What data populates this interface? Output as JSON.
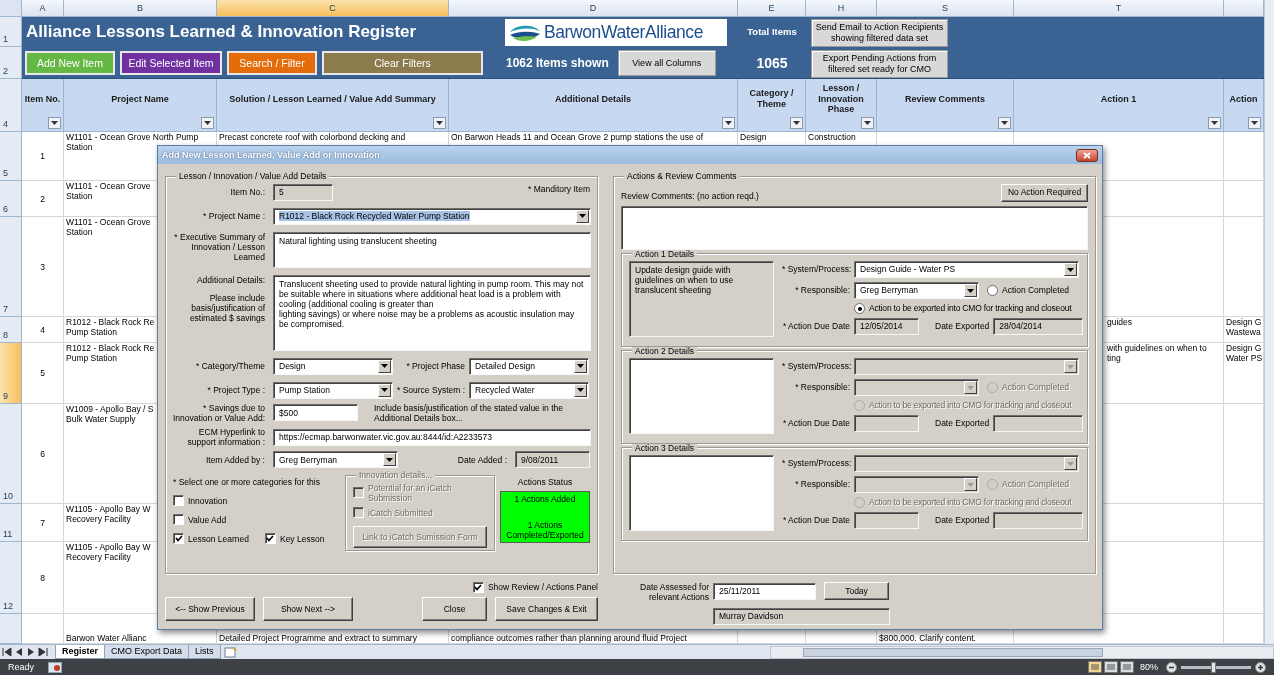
{
  "sheet": {
    "title": "Alliance Lessons Learned & Innovation Register",
    "columns": [
      {
        "letter": "A",
        "selected": false
      },
      {
        "letter": "B",
        "selected": false
      },
      {
        "letter": "C",
        "selected": true
      },
      {
        "letter": "D",
        "selected": false
      },
      {
        "letter": "E",
        "selected": false
      },
      {
        "letter": "H",
        "selected": false
      },
      {
        "letter": "S",
        "selected": false
      },
      {
        "letter": "T",
        "selected": false
      },
      {
        "selected": false
      }
    ],
    "toolbar_buttons": [
      {
        "label": "Add New Item",
        "color": "#66b845"
      },
      {
        "label": "Edit Selected Item",
        "color": "#7030a0"
      },
      {
        "label": "Search / Filter",
        "color": "#e46c0a"
      },
      {
        "label": "Clear Filters",
        "color": "#8c7b4c"
      }
    ],
    "logo": "BarwonWaterAlliance",
    "items_shown": "1062 Items shown",
    "view_button": "View all Columns",
    "total_label": "Total Items",
    "total_value": "1065",
    "side_buttons": [
      "Send Email to Action Recipients showing filtered data set",
      "Export Pending Actions from filtered set ready for CMO"
    ],
    "header_rows": [
      "1",
      "2",
      "4"
    ],
    "headers": [
      "Item No.",
      "Project Name",
      "Solution / Lesson Learned / Value Add Summary",
      "Additional Details",
      "Category / Theme",
      "Lesson / Innovation Phase",
      "Review Comments",
      "Action 1",
      "Action"
    ],
    "rows": [
      {
        "label": "5",
        "selected": false,
        "cells": {
          "A": [
            "1"
          ],
          "B": [
            "W1101 - Ocean Grove North Pump",
            "Station"
          ],
          "C": [
            "Precast concrete roof with colorbond decking and"
          ],
          "D": [
            "On Barwon Heads 11 and Ocean Grove 2 pump stations the use of"
          ],
          "E": [
            "Design"
          ],
          "H": [
            "Construction"
          ]
        }
      },
      {
        "label": "6",
        "selected": false,
        "cells": {
          "A": [
            "2"
          ],
          "B": [
            "W1101 - Ocean Grove",
            "Station"
          ]
        }
      },
      {
        "label": "7",
        "selected": false,
        "cells": {
          "A": [
            "3"
          ],
          "B": [
            "W1101 - Ocean Grove",
            "Station"
          ]
        }
      },
      {
        "label": "8",
        "selected": false,
        "cells": {
          "A": [
            "4"
          ],
          "B": [
            "R1012 - Black Rock Re",
            "Pump Station"
          ],
          "T": [
            "guides"
          ],
          "column_9": [
            "Design G",
            "Wastewa"
          ]
        }
      },
      {
        "label": "9",
        "selected": true,
        "cells": {
          "A": [
            "5"
          ],
          "B": [
            "R1012 - Black Rock Re",
            "Pump Station"
          ],
          "T": [
            "with guidelines on when to",
            "ting"
          ],
          "column_9": [
            "Design G",
            "Water PS"
          ]
        }
      },
      {
        "label": "10",
        "selected": false,
        "cells": {
          "A": [
            "6"
          ],
          "B": [
            "W1009 - Apollo Bay / S",
            "Bulk Water Supply"
          ]
        }
      },
      {
        "label": "11",
        "selected": false,
        "cells": {
          "A": [
            "7"
          ],
          "B": [
            "W1105 - Apollo Bay W",
            "Recovery Facility"
          ]
        }
      },
      {
        "label": "12",
        "selected": false,
        "cells": {
          "A": [
            "8"
          ],
          "B": [
            "W1105 - Apollo Bay W",
            "Recovery Facility"
          ]
        }
      },
      {
        "selected": false,
        "cells": {
          "B": [
            "Barwon Water Allianc"
          ],
          "C": [
            "Detailed Project Programme and extract to summary"
          ],
          "D": [
            "compliance outcomes rather than planning around fluid Project"
          ],
          "S": [
            "$800,000. Clarify content."
          ]
        }
      }
    ]
  },
  "dialog": {
    "title": "Add New Lesson Learned, Value Add or Innovation",
    "details": {
      "legend": "Lesson / Innovation / Value Add Details",
      "mandatory_note": "* Manditory Item",
      "item_no": {
        "label": "Item No.:",
        "value": "5"
      },
      "project_name": {
        "label": "* Project Name :",
        "value": "R1012 - Black Rock Recycled Water Pump Station",
        "text_selected": true
      },
      "summary": {
        "label": "* Executive Summary of Innovation / Lesson Learned",
        "value": "Natural lighting using translucent sheeting"
      },
      "additional": {
        "label": "Additional Details:",
        "hint": "Please include basis/justification of estimated $ savings",
        "value": "Translucent sheeting used to provide natural lighting in pump room. This may not be suitable where in situations where additional heat load is a problem with cooling (additional cooling is greater than\nlighting savings) or where noise may be a problems as acoustic insulation may be compromised."
      },
      "category": {
        "label": "* Category/Theme",
        "value": "Design"
      },
      "phase": {
        "label": "* Project Phase",
        "value": "Detailed Design"
      },
      "project_type": {
        "label": "* Project Type :",
        "value": "Pump Station"
      },
      "source_system": {
        "label": "* Source System :",
        "value": "Recycled Water"
      },
      "savings": {
        "label": "* Savings due to Innovation or Value Add:",
        "value": "$500",
        "note": "Include basis/justification of the stated value in the Additional Details box..."
      },
      "ecm_link": {
        "label": "ECM Hyperlink to support information :",
        "value": "https://ecmap.barwonwater.vic.gov.au:8444/id:A2233573"
      },
      "added_by": {
        "label": "Item Added by :",
        "value": "Greg Berryman"
      },
      "date_added": {
        "label": "Date Added :",
        "value": "9/08/2011"
      },
      "categories_prompt": "* Select one or more categories for this",
      "categories": [
        {
          "label": "Innovation",
          "checked": false
        },
        {
          "label": "Value Add",
          "checked": false
        },
        {
          "label": "Lesson Learned",
          "checked": true
        },
        {
          "label": "Key Lesson",
          "checked": true
        }
      ],
      "innovation": {
        "legend": "Innovation details...",
        "disabled": true,
        "checks": [
          {
            "label": "Potential for an iCatch Submission",
            "checked": false
          },
          {
            "label": "iCatch Submitted",
            "checked": false
          }
        ],
        "button": "Link to iCatch Sumission Form"
      },
      "status": {
        "label": "Actions Status",
        "color": "#00ff00",
        "lines": [
          "1 Actions Added",
          "1 Actions Completed/Exported"
        ]
      }
    },
    "actions_panel": {
      "legend": "Actions & Review Comments",
      "review_label": "Review Comments: (no action reqd.)",
      "no_action_button": "No Action Required",
      "actions": [
        {
          "legend": "Action 1 Details",
          "disabled": false,
          "locked": true,
          "description": "Update design guide with guidelines on when to use translucent sheeting",
          "system_label": "* System/Process:",
          "system": "Design Guide - Water PS",
          "responsible_label": "* Responsible:",
          "responsible": "Greg Berryman",
          "completed": {
            "label": "Action Completed",
            "selected": false
          },
          "export": {
            "label": "Action to be exported into CMO for tracking and closeout",
            "selected": true
          },
          "due_label": "* Action Due Date",
          "due": "12/05/2014",
          "exported_label": "Date Exported",
          "exported": "28/04/2014"
        },
        {
          "legend": "Action 2 Details",
          "disabled": true,
          "locked": false,
          "system_label": "* System/Process:",
          "responsible_label": "* Responsible:",
          "completed": {
            "label": "Action Completed",
            "selected": false
          },
          "export": {
            "label": "Action to be exported into CMO for tracking and closeout",
            "selected": false
          },
          "due_label": "* Action Due Date",
          "exported_label": "Date Exported"
        },
        {
          "legend": "Action 3 Details",
          "disabled": true,
          "locked": false,
          "system_label": "* System/Process:",
          "responsible_label": "* Responsible:",
          "completed": {
            "label": "Action Completed",
            "selected": false
          },
          "export": {
            "label": "Action to be exported into CMO for tracking and closeout",
            "selected": false
          },
          "due_label": "* Action Due Date",
          "exported_label": "Date Exported"
        }
      ],
      "assessed_label": "Date Assessed for relevant Actions",
      "assessed": "25/11/2011",
      "today_button": "Today",
      "assessor": "Murray Davidson"
    },
    "show_panel": {
      "label": "Show Review / Actions Panel",
      "checked": true
    },
    "buttons": [
      "<-- Show Previous",
      "Show Next -->",
      "Close",
      "Save Changes & Exit"
    ]
  },
  "sheet_tabs": [
    {
      "label": "Register",
      "selected": true
    },
    {
      "label": "CMO Export Data",
      "selected": false
    },
    {
      "label": "Lists",
      "selected": false
    }
  ],
  "status_bar": {
    "text": "Ready",
    "zoom": {
      "reading": "80%",
      "level": 0.45
    }
  }
}
